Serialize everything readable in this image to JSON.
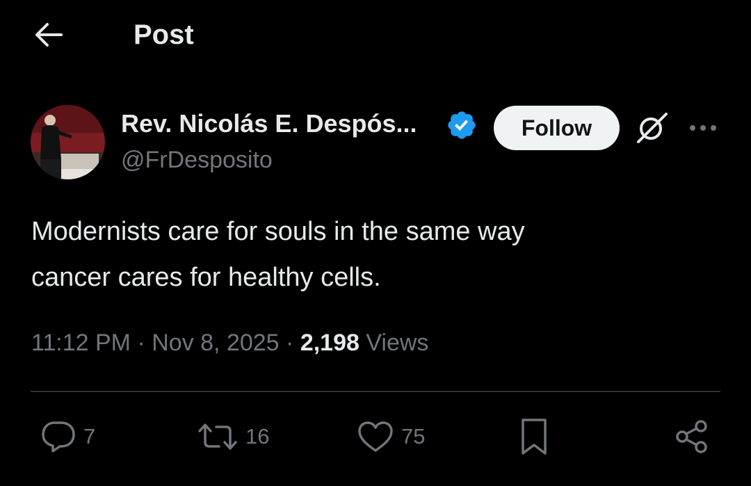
{
  "header": {
    "back_icon": "arrow-left-icon",
    "title": "Post"
  },
  "author": {
    "display_name": "Rev. Nicolás E. Despós...",
    "handle": "@FrDesposito",
    "verified_icon": "verified-badge-icon",
    "follow_label": "Follow",
    "grok_icon": "grok-icon",
    "more_icon": "more-horizontal-icon"
  },
  "tweet": {
    "lines": [
      "Modernists care for souls in the same way",
      "cancer cares for healthy cells."
    ]
  },
  "meta": {
    "time": "11:12 PM",
    "separator": " · ",
    "date": "Nov 8, 2025",
    "views_count": "2,198",
    "views_label": " Views"
  },
  "actions": {
    "replies": "7",
    "reposts": "16",
    "likes": "75"
  },
  "colors": {
    "background": "#000000",
    "text_primary": "#e7e9ea",
    "text_secondary": "#71767b",
    "verified": "#1d9bf0",
    "follow_bg": "#eff3f4",
    "divider": "#2f3336"
  }
}
